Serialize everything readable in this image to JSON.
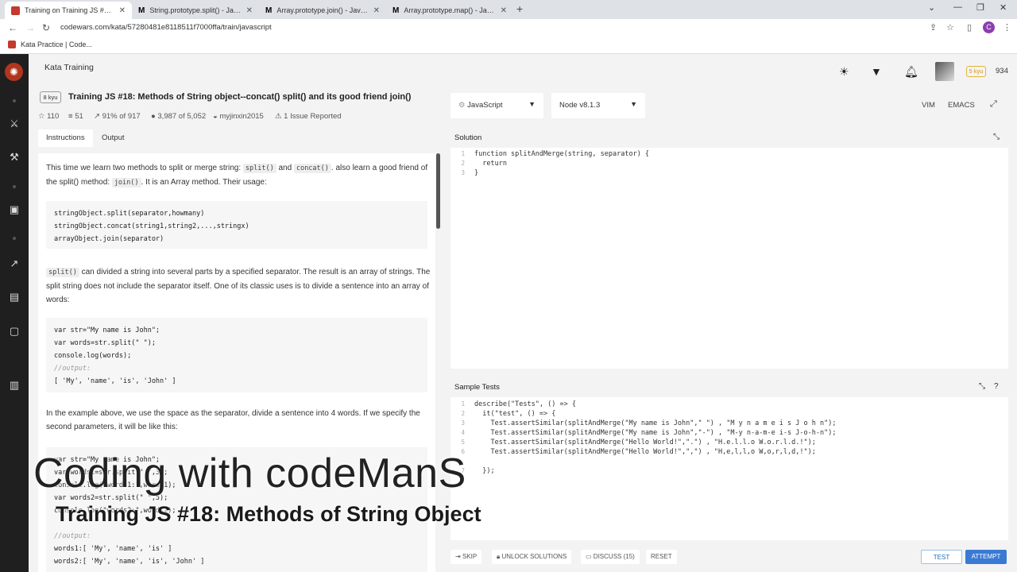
{
  "browser": {
    "tabs": [
      {
        "title": "Training on Training JS #18: Meth",
        "favicon": "codewars",
        "active": true
      },
      {
        "title": "String.prototype.split() - JavaScrip",
        "favicon": "mdn",
        "active": false
      },
      {
        "title": "Array.prototype.join() - JavaScrip",
        "favicon": "mdn",
        "active": false
      },
      {
        "title": "Array.prototype.map() - JavaScrip",
        "favicon": "mdn",
        "active": false
      }
    ],
    "url": "codewars.com/kata/57280481e8118511f7000ffa/train/javascript",
    "profile_initial": "C",
    "bookmark": "Kata Practice | Code..."
  },
  "header": {
    "section": "Kata Training",
    "rank": "5 kyu",
    "honor": "934"
  },
  "kata": {
    "kyu": "8 kyu",
    "title": "Training JS #18: Methods of String object--concat() split() and its good friend join()",
    "stars": "110",
    "collections": "51",
    "satisfaction": "91% of 917",
    "completed": "3,987 of 5,052",
    "author": "myjinxin2015",
    "issues": "1 Issue Reported"
  },
  "instruction_tabs": [
    "Instructions",
    "Output"
  ],
  "description": {
    "p1_a": "This time we learn two methods to split or merge string: ",
    "p1_code1": "split()",
    "p1_b": " and ",
    "p1_code2": "concat()",
    "p1_c": ". also learn a good friend of the split() method: ",
    "p1_code3": "join()",
    "p1_d": ". It is an Array method. Their usage:",
    "code1": [
      "stringObject.split(separator,howmany)",
      "stringObject.concat(string1,string2,...,stringx)",
      "arrayObject.join(separator)"
    ],
    "p2_code": "split()",
    "p2_text": " can divided a string into several parts by a specified separator. The result is an array of strings. The split string does not include the separator itself. One of its classic uses is to divide a sentence into an array of words:",
    "code2": [
      "var str=\"My name is John\";",
      "var words=str.split(\" \");",
      "console.log(words);"
    ],
    "code2_comment": "//output:",
    "code2_out": "[ 'My', 'name', 'is', 'John' ]",
    "p3": "In the example above, we use the space as the separator, divide a sentence into 4 words. If we specify the second parameters, it will be like this:",
    "code3": [
      "var str=\"My name is John\";",
      "var words1=str.split(\" \",3);",
      "console.log(\"words1:\",words1);",
      "var words2=str.split(\" \",5);",
      "console.log(\"words2:\",words2);"
    ],
    "code3_comment": "//output:",
    "code3_out": [
      "words1:[ 'My', 'name', 'is' ]",
      "words2:[ 'My', 'name', 'is', 'John' ]"
    ]
  },
  "editor": {
    "language": "JavaScript",
    "runtime": "Node v8.1.3",
    "mode_vim": "VIM",
    "mode_emacs": "EMACS",
    "solution_title": "Solution",
    "solution_lines": [
      {
        "n": "1",
        "text": "function splitAndMerge(string, separator) {"
      },
      {
        "n": "2",
        "text": "  return"
      },
      {
        "n": "3",
        "text": "}"
      }
    ],
    "tests_title": "Sample Tests",
    "test_lines": [
      {
        "n": "1",
        "text": "describe(\"Tests\", () => {"
      },
      {
        "n": "2",
        "text": "  it(\"test\", () => {"
      },
      {
        "n": "3",
        "text": "    Test.assertSimilar(splitAndMerge(\"My name is John\",\" \") , \"M y n a m e i s J o h n\");"
      },
      {
        "n": "4",
        "text": "    Test.assertSimilar(splitAndMerge(\"My name is John\",\"-\") , \"M-y n-a-m-e i-s J-o-h-n\");"
      },
      {
        "n": "5",
        "text": "    Test.assertSimilar(splitAndMerge(\"Hello World!\",\".\") , \"H.e.l.l.o W.o.r.l.d.!\");"
      },
      {
        "n": "6",
        "text": "    Test.assertSimilar(splitAndMerge(\"Hello World!\",\",\") , \"H,e,l,l,o W,o,r,l,d,!\");"
      },
      {
        "n": "7",
        "text": "  });"
      }
    ]
  },
  "actions": {
    "skip": "SKIP",
    "unlock": "UNLOCK SOLUTIONS",
    "discuss": "DISCUSS (15)",
    "reset": "RESET",
    "test": "TEST",
    "attempt": "ATTEMPT"
  },
  "overlay": {
    "line1": "Coding with codeManS",
    "line2": "Training JS #18: Methods of String Object"
  }
}
